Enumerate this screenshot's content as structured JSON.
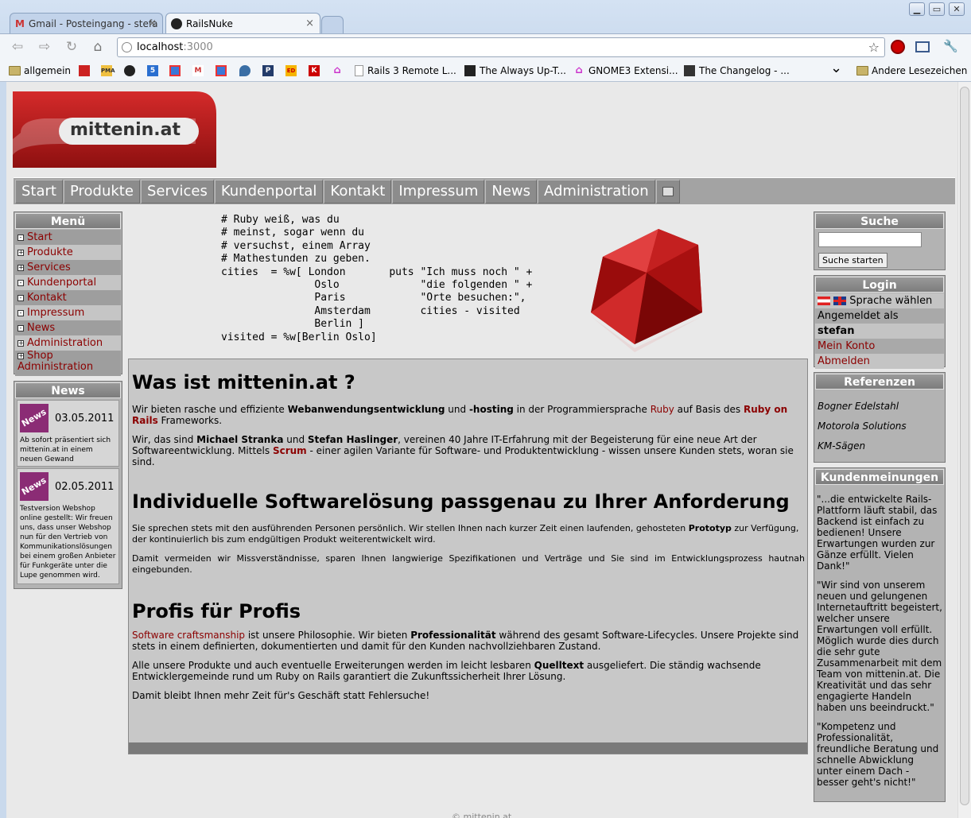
{
  "browser": {
    "tabs": [
      {
        "title": "Gmail - Posteingang - stefa",
        "icon": "gmail-icon",
        "close": "×"
      },
      {
        "title": "RailsNuke",
        "icon": "motorola-icon",
        "close": "×"
      }
    ],
    "window_buttons": {
      "minimize": "▁",
      "maximize": "▭",
      "close": "✕"
    },
    "url_host": "localhost",
    "url_port": ":3000",
    "nav_glyphs": {
      "back": "⇦",
      "forward": "⇨",
      "reload": "↻",
      "home": "⌂"
    },
    "star_glyph": "☆",
    "wrench_glyph": "🔧",
    "bookmarks": [
      {
        "label": "allgemein",
        "icon": "folder-icon"
      },
      {
        "label": "",
        "icon": "red-square-icon"
      },
      {
        "label": "",
        "icon": "pma-icon"
      },
      {
        "label": "",
        "icon": "motorola-icon"
      },
      {
        "label": "",
        "icon": "five-icon"
      },
      {
        "label": "",
        "icon": "puzzle-icon"
      },
      {
        "label": "",
        "icon": "gmail-icon"
      },
      {
        "label": "",
        "icon": "puzzle-icon"
      },
      {
        "label": "",
        "icon": "drop-icon"
      },
      {
        "label": "",
        "icon": "p-icon"
      },
      {
        "label": "",
        "icon": "ed-icon"
      },
      {
        "label": "",
        "icon": "k-icon"
      },
      {
        "label": "",
        "icon": "house-icon"
      },
      {
        "label": "Rails 3 Remote L...",
        "icon": "page-icon"
      },
      {
        "label": "The Always Up-T...",
        "icon": "ruler-icon"
      },
      {
        "label": "GNOME3 Extensi...",
        "icon": "gnome-icon"
      },
      {
        "label": "The Changelog - ...",
        "icon": "changelog-icon"
      }
    ],
    "bookmarks_overflow": "⌄",
    "other_bookmarks": "Andere Lesezeichen"
  },
  "site": {
    "logo_text": "mittenin.at",
    "nav": [
      "Start",
      "Produkte",
      "Services",
      "Kundenportal",
      "Kontakt",
      "Impressum",
      "News",
      "Administration"
    ],
    "menu": {
      "title": "Menü",
      "items": [
        {
          "label": "Start",
          "sign": "-"
        },
        {
          "label": "Produkte",
          "sign": "+"
        },
        {
          "label": "Services",
          "sign": "+"
        },
        {
          "label": "Kundenportal",
          "sign": "-"
        },
        {
          "label": "Kontakt",
          "sign": "-"
        },
        {
          "label": "Impressum",
          "sign": "-"
        },
        {
          "label": "News",
          "sign": "-"
        },
        {
          "label": "Administration",
          "sign": "+"
        },
        {
          "label": "Shop",
          "label2": "Administration",
          "sign": "+"
        }
      ]
    },
    "news": {
      "title": "News",
      "badge": "News",
      "items": [
        {
          "date": "03.05.2011",
          "text": "Ab sofort präsentiert sich mittenin.at in einem neuen Gewand"
        },
        {
          "date": "02.05.2011",
          "text": "Testversion Webshop online gestellt: Wir freuen uns, dass unser Webshop nun für den Vertrieb von Kommunikationslösungen bei einem großen Anbieter für Funkgeräte unter die Lupe genommen wird."
        }
      ]
    },
    "code_lines": [
      "# Ruby weiß, was du",
      "# meinst, sogar wenn du",
      "# versuchst, einem Array",
      "# Mathestunden zu geben.",
      "cities  = %w[ London       puts \"Ich muss noch \" +",
      "               Oslo             \"die folgenden \" +",
      "               Paris            \"Orte besuchen:\",",
      "               Amsterdam        cities - visited",
      "               Berlin ]",
      "visited = %w[Berlin Oslo]"
    ],
    "content": {
      "h1": "Was ist mittenin.at ?",
      "p1": {
        "a": "Wir bieten rasche und effiziente ",
        "b1": "Webanwendungsentwicklung",
        "c": " und ",
        "b2": "-hosting",
        "d": " in der Programmiersprache ",
        "ruby": "Ruby",
        "e": " auf Basis des ",
        "ror": "Ruby on Rails",
        "f": " Frameworks."
      },
      "p2": {
        "a": "Wir, das sind ",
        "n1": "Michael Stranka",
        "b": " und ",
        "n2": "Stefan Haslinger",
        "c": ", vereinen 40 Jahre IT-Erfahrung mit der Begeisterung für eine neue Art der Softwareentwicklung. Mittels ",
        "scrum": "Scrum",
        "d": " - einer agilen Variante für Software- und Produktentwicklung - wissen unsere Kunden stets, woran sie sind."
      },
      "h2": "Individuelle Softwarelösung passgenau zu Ihrer Anforderung",
      "p3": {
        "a": "Sie sprechen stets mit den ausführenden Personen persönlich. Wir stellen Ihnen nach kurzer Zeit einen laufenden, gehosteten ",
        "b": "Prototyp",
        "c": " zur Verfügung, der kontinuierlich bis zum endgültigen Produkt weiterentwickelt wird."
      },
      "p4": "Damit vermeiden wir Missverständnisse, sparen Ihnen langwierige Spezifikationen und Verträge und Sie sind im Entwicklungsprozess hautnah eingebunden.",
      "h3": "Profis für Profis",
      "p5": {
        "link": "Software craftsmanship",
        "a": " ist unsere Philosophie. Wir bieten ",
        "b": "Professionalität",
        "c": " während des gesamt Software-Lifecycles. Unsere Projekte sind stets in einem definierten, dokumentierten und damit für den Kunden nachvollziehbaren Zustand."
      },
      "p6": {
        "a": "Alle unsere Produkte und auch eventuelle Erweiterungen werden im leicht lesbaren ",
        "b": "Quelltext",
        "c": " ausgeliefert. Die ständig wachsende Entwicklergemeinde rund um Ruby on Rails garantiert die Zukunftssicherheit Ihrer Lösung."
      },
      "p7": "Damit bleibt Ihnen mehr Zeit für's Geschäft statt Fehlersuche!"
    },
    "search": {
      "title": "Suche",
      "value": "",
      "button": "Suche starten"
    },
    "login": {
      "title": "Login",
      "language": "Sprache wählen",
      "logged_in_as": "Angemeldet als",
      "user": "stefan",
      "account": "Mein Konto",
      "logout": "Abmelden"
    },
    "references": {
      "title": "Referenzen",
      "items": [
        "Bogner Edelstahl",
        "Motorola Solutions",
        "KM-Sägen"
      ]
    },
    "testimonials": {
      "title": "Kundenmeinungen",
      "items": [
        "\"...die entwickelte Rails-Plattform läuft stabil, das Backend ist einfach zu bedienen! Unsere Erwartungen wurden zur Gänze erfüllt. Vielen Dank!\"",
        "\"Wir sind von unserem neuen und gelungenen Internetauftritt begeistert, welcher unsere Erwartungen voll erfüllt. Möglich wurde dies durch die sehr gute Zusammenarbeit mit dem Team von mittenin.at. Die Kreativität und das sehr engagierte Handeln haben uns beeindruckt.\"",
        "\"Kompetenz und Professionalität, freundliche Beratung und schnelle Abwicklung unter einem Dach - besser geht's nicht!\""
      ]
    },
    "footer": "© mittenin.at"
  },
  "colors": {
    "link": "#8b0000",
    "box": "#b3b3b3",
    "nav": "#8c8c8c"
  }
}
